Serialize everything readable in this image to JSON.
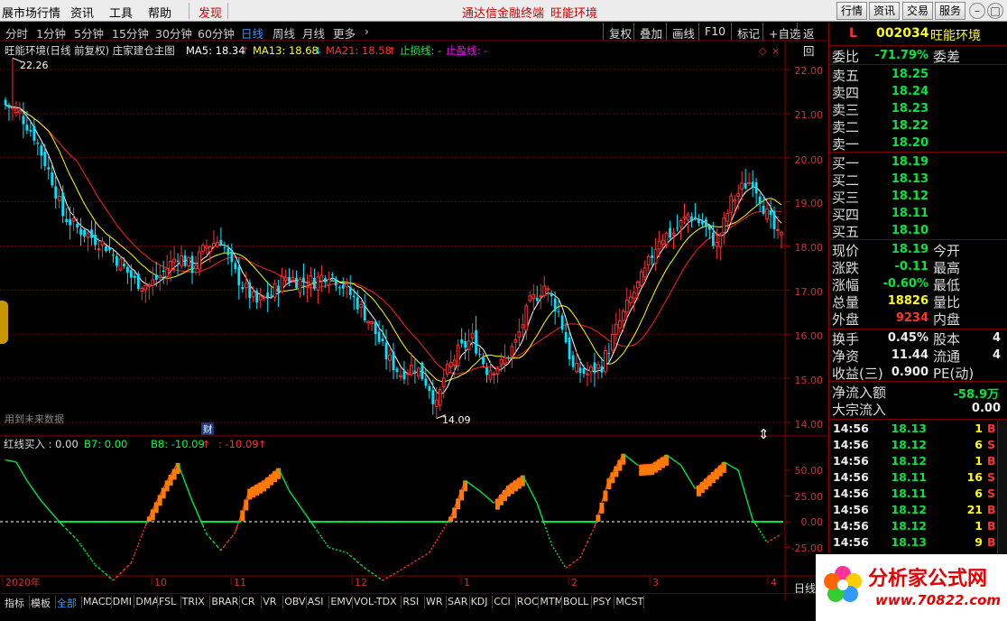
{
  "menubar": {
    "items": [
      "展市场行情",
      "资讯",
      "工具",
      "帮助"
    ],
    "discover": "发现",
    "center_left": "通达信金融终端",
    "center_right": "旺能环境",
    "right_buttons": [
      "行情",
      "资讯",
      "交易",
      "服务"
    ],
    "win_buttons": [
      "–",
      "□",
      "×"
    ]
  },
  "period_bar": {
    "items": [
      "分时",
      "1分钟",
      "5分钟",
      "15分钟",
      "30分钟",
      "60分钟",
      "日线",
      "周线",
      "月线",
      "更多",
      "›"
    ],
    "active": "日线"
  },
  "toolbar": {
    "items": [
      "复权",
      "叠加",
      "画线",
      "F10",
      "标记",
      "+自选",
      "返回"
    ]
  },
  "main_legend": {
    "title": "旺能环境(日线 前复权) 庄家建仓主图",
    "ma5": "MA5: 18.34",
    "ma13": "MA13: 18.68",
    "ma21": "MA21: 18.58",
    "stop_loss": "止损线: -",
    "take_profit": "止盈线: -"
  },
  "sub_legend": {
    "title": "红线买入 : 0.00",
    "b7": "B7: 0.00",
    "b8": "B8: -10.09",
    "b9": ": -10.09"
  },
  "annotations": {
    "high": "22.26",
    "low": "14.09",
    "future_data": "用到未来数据",
    "fin_mark": "财",
    "more_arrow": "⇕"
  },
  "main_axis": [
    "22.00",
    "21.00",
    "20.00",
    "19.00",
    "18.00",
    "17.00",
    "16.00",
    "15.00",
    "14.00"
  ],
  "sub_axis": [
    "50.00",
    "25.00",
    "0.00",
    "-25.00"
  ],
  "date_axis": [
    {
      "label": "2020年",
      "x": 3
    },
    {
      "label": "10",
      "x": 168
    },
    {
      "label": "11",
      "x": 256
    },
    {
      "label": "12",
      "x": 390
    },
    {
      "label": "1",
      "x": 511
    },
    {
      "label": "2",
      "x": 630
    },
    {
      "label": "3",
      "x": 720
    },
    {
      "label": "4",
      "x": 851
    }
  ],
  "day_label": "日线",
  "bottom_tabs": [
    "指标",
    "模板",
    "全部",
    "MACD",
    "DMI",
    "DMA",
    "FSL",
    "TRIX",
    "BRAR",
    "CR",
    "VR",
    "OBV",
    "ASI",
    "EMV",
    "VOL-TDX",
    "RSI",
    "WR",
    "SAR",
    "KDJ",
    "CCI",
    "ROC",
    "MTM",
    "BOLL",
    "PSY",
    "MCST"
  ],
  "bottom_active": "全部",
  "quote": {
    "code": "002034",
    "name": "旺能环境",
    "marker": "L",
    "weibi_label": "委比",
    "weibi": "-71.79%",
    "weicha_label": "委差",
    "asks": [
      {
        "label": "卖五",
        "price": "18.25"
      },
      {
        "label": "卖四",
        "price": "18.24"
      },
      {
        "label": "卖三",
        "price": "18.23"
      },
      {
        "label": "卖二",
        "price": "18.22"
      },
      {
        "label": "卖一",
        "price": "18.20"
      }
    ],
    "bids": [
      {
        "label": "买一",
        "price": "18.19"
      },
      {
        "label": "买二",
        "price": "18.13"
      },
      {
        "label": "买三",
        "price": "18.12"
      },
      {
        "label": "买四",
        "price": "18.11"
      },
      {
        "label": "买五",
        "price": "18.10"
      }
    ],
    "stats": [
      {
        "label": "现价",
        "value": "18.19",
        "label2": "今开"
      },
      {
        "label": "涨跌",
        "value": "-0.11",
        "label2": "最高"
      },
      {
        "label": "涨幅",
        "value": "-0.60%",
        "label2": "最低"
      },
      {
        "label": "总量",
        "value": "18826",
        "label2": "量比"
      },
      {
        "label": "外盘",
        "value": "9234",
        "label2": "内盘"
      }
    ],
    "stats2": [
      {
        "label": "换手",
        "value": "0.45%",
        "label2": "股本",
        "tail": "4"
      },
      {
        "label": "净资",
        "value": "11.44",
        "label2": "流通",
        "tail": "4"
      },
      {
        "label": "收益(三)",
        "value": "0.900",
        "label2": "PE(动)",
        "tail": ""
      }
    ],
    "netflow_label": "净流入额",
    "netflow": "-58.9万",
    "bigflow_label": "大宗流入",
    "bigflow": "0.00",
    "ticks": [
      {
        "time": "14:56",
        "price": "18.13",
        "vol": "1",
        "bs": "B"
      },
      {
        "time": "14:56",
        "price": "18.12",
        "vol": "6",
        "bs": "S"
      },
      {
        "time": "14:56",
        "price": "18.12",
        "vol": "1",
        "bs": "B"
      },
      {
        "time": "14:56",
        "price": "18.11",
        "vol": "16",
        "bs": "S"
      },
      {
        "time": "14:56",
        "price": "18.11",
        "vol": "6",
        "bs": "S"
      },
      {
        "time": "14:56",
        "price": "18.12",
        "vol": "21",
        "bs": "B"
      },
      {
        "time": "14:56",
        "price": "18.12",
        "vol": "1",
        "bs": "B"
      },
      {
        "time": "14:56",
        "price": "18.13",
        "vol": "9",
        "bs": "B"
      },
      {
        "time": "14:56",
        "price": "18.12",
        "vol": "19",
        "bs": "B"
      }
    ]
  },
  "watermark": {
    "text": "分析家公式网",
    "url": "www.70822.com"
  },
  "colors": {
    "up": "#ff3232",
    "down": "#00e5ff",
    "ma5": "#ffffff",
    "ma13": "#ffff00",
    "ma21": "#ff2020",
    "grid": "#8b0000"
  },
  "chart_data": {
    "type": "candlestick",
    "title": "旺能环境(日线 前复权) 庄家建仓主图",
    "ylim": [
      14.0,
      22.4
    ],
    "yticks": [
      14,
      15,
      16,
      17,
      18,
      19,
      20,
      21,
      22
    ],
    "anchors_close": [
      [
        0,
        21.2
      ],
      [
        4,
        21.0
      ],
      [
        8,
        20.5
      ],
      [
        13,
        19.5
      ],
      [
        16,
        18.7
      ],
      [
        20,
        18.4
      ],
      [
        24,
        18.2
      ],
      [
        28,
        18.0
      ],
      [
        32,
        17.6
      ],
      [
        36,
        17.2
      ],
      [
        40,
        17.1
      ],
      [
        44,
        17.4
      ],
      [
        48,
        17.8
      ],
      [
        52,
        17.5
      ],
      [
        56,
        18.0
      ],
      [
        60,
        18.15
      ],
      [
        63,
        17.5
      ],
      [
        66,
        17.1
      ],
      [
        70,
        16.7
      ],
      [
        74,
        16.9
      ],
      [
        78,
        17.3
      ],
      [
        82,
        17.2
      ],
      [
        86,
        17.2
      ],
      [
        90,
        17.4
      ],
      [
        94,
        17.1
      ],
      [
        98,
        16.7
      ],
      [
        102,
        16.2
      ],
      [
        106,
        15.5
      ],
      [
        110,
        15.1
      ],
      [
        114,
        15.3
      ],
      [
        118,
        14.8
      ],
      [
        120,
        14.35
      ],
      [
        122,
        15.0
      ],
      [
        126,
        15.6
      ],
      [
        130,
        15.9
      ],
      [
        134,
        15.2
      ],
      [
        138,
        15.3
      ],
      [
        142,
        15.8
      ],
      [
        146,
        16.7
      ],
      [
        150,
        17.1
      ],
      [
        154,
        16.5
      ],
      [
        158,
        15.2
      ],
      [
        162,
        15.1
      ],
      [
        166,
        15.3
      ],
      [
        170,
        16.1
      ],
      [
        174,
        16.8
      ],
      [
        178,
        17.4
      ],
      [
        182,
        18.2
      ],
      [
        186,
        18.3
      ],
      [
        190,
        18.7
      ],
      [
        194,
        18.5
      ],
      [
        198,
        18.0
      ],
      [
        202,
        19.0
      ],
      [
        206,
        19.4
      ],
      [
        208,
        19.5
      ],
      [
        212,
        18.7
      ],
      [
        215,
        18.2
      ],
      [
        216,
        18.19
      ]
    ],
    "sub_anchors": [
      [
        0,
        60
      ],
      [
        3,
        58
      ],
      [
        6,
        40
      ],
      [
        10,
        20
      ],
      [
        15,
        0
      ],
      [
        20,
        -18
      ],
      [
        25,
        -42
      ],
      [
        30,
        -57
      ],
      [
        35,
        -40
      ],
      [
        40,
        5
      ],
      [
        45,
        40
      ],
      [
        48,
        57
      ],
      [
        52,
        20
      ],
      [
        56,
        -12
      ],
      [
        60,
        -28
      ],
      [
        64,
        -10
      ],
      [
        68,
        32
      ],
      [
        72,
        40
      ],
      [
        76,
        52
      ],
      [
        79,
        30
      ],
      [
        84,
        5
      ],
      [
        90,
        -25
      ],
      [
        95,
        -30
      ],
      [
        100,
        -45
      ],
      [
        105,
        -57
      ],
      [
        110,
        -47
      ],
      [
        118,
        -30
      ],
      [
        124,
        5
      ],
      [
        128,
        40
      ],
      [
        132,
        30
      ],
      [
        136,
        18
      ],
      [
        140,
        35
      ],
      [
        144,
        45
      ],
      [
        148,
        18
      ],
      [
        152,
        -22
      ],
      [
        156,
        -45
      ],
      [
        160,
        -35
      ],
      [
        164,
        -5
      ],
      [
        168,
        42
      ],
      [
        172,
        66
      ],
      [
        176,
        55
      ],
      [
        180,
        56
      ],
      [
        184,
        65
      ],
      [
        188,
        55
      ],
      [
        192,
        32
      ],
      [
        196,
        45
      ],
      [
        200,
        58
      ],
      [
        204,
        50
      ],
      [
        208,
        2
      ],
      [
        212,
        -20
      ],
      [
        216,
        -12
      ]
    ],
    "sub_ylim": [
      -65,
      75
    ],
    "sub_yticks": [
      50,
      25,
      0,
      -25
    ],
    "bars": 217
  }
}
